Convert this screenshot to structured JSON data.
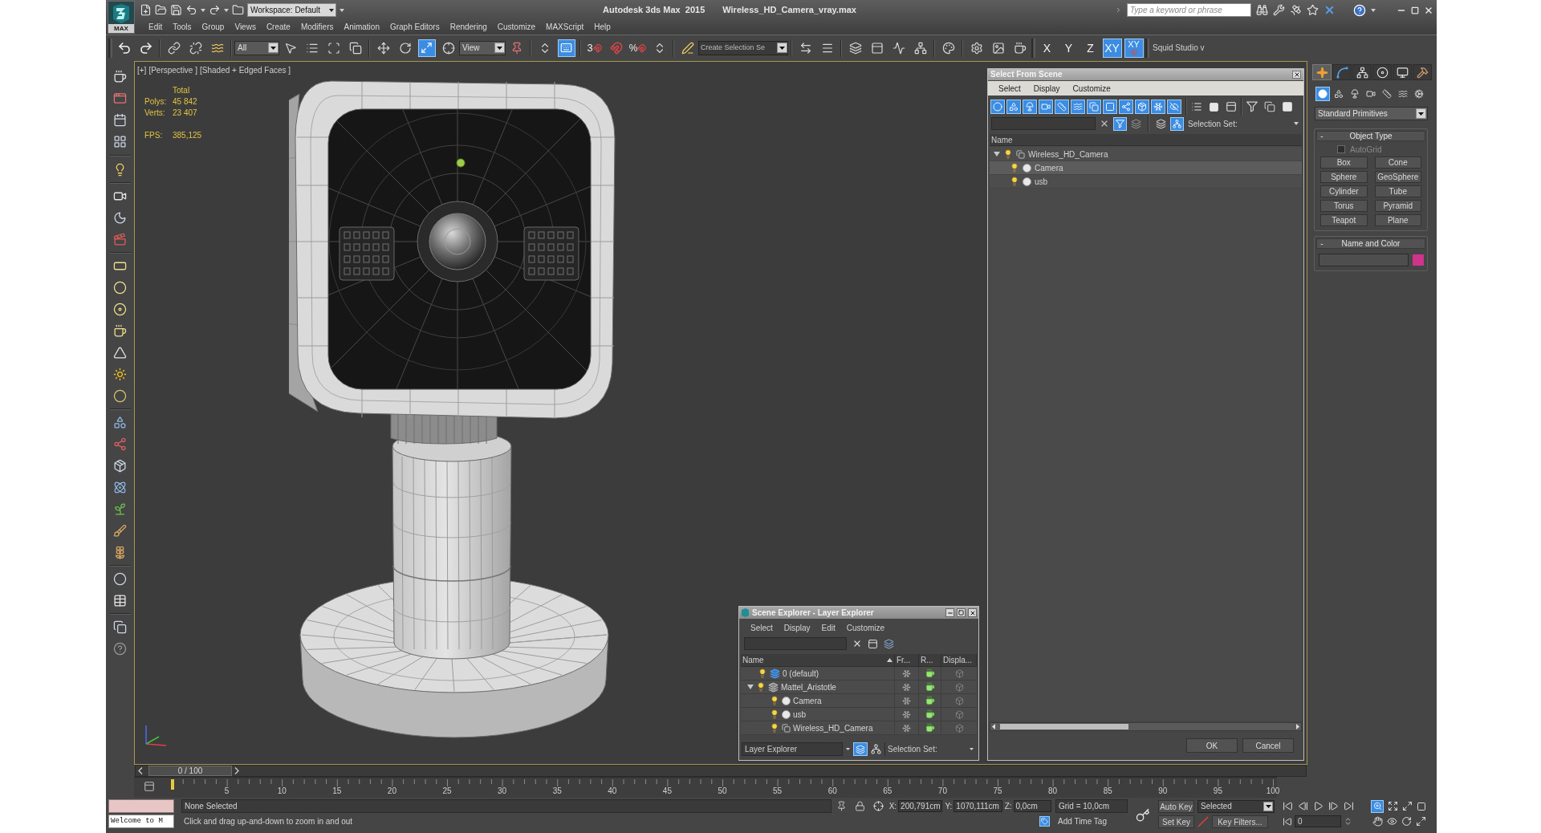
{
  "title_bar": {
    "app_button": "MAX",
    "workspace": "Workspace: Default",
    "app_name": "Autodesk 3ds Max  2015",
    "file_name": "Wireless_HD_Camera_vray.max",
    "search": {
      "placeholder": "Type a keyword or phrase"
    }
  },
  "menu": [
    "Edit",
    "Tools",
    "Group",
    "Views",
    "Create",
    "Modifiers",
    "Animation",
    "Graph Editors",
    "Rendering",
    "Customize",
    "MAXScript",
    "Help"
  ],
  "main_toolbar": {
    "selection_filter": "All",
    "scale_tool": {
      "active": true
    },
    "reference_coordinate": "View",
    "shortcut_override": {
      "active": true
    },
    "snap_toggle": "3",
    "percent_snap": "%",
    "named_selection": "Create Selection Se",
    "axis_constraints": [
      {
        "kind": "axis",
        "label": "X",
        "selected": false
      },
      {
        "kind": "axis",
        "label": "Y",
        "selected": false
      },
      {
        "kind": "axis",
        "label": "Z",
        "selected": false
      },
      {
        "kind": "axis",
        "label": "XY",
        "selected": true
      },
      {
        "kind": "snap",
        "label": "XY",
        "selected": true
      }
    ],
    "extra_toolbar": "Squid Studio v"
  },
  "viewport": {
    "labels": [
      "[+]",
      "[Perspective ]",
      "[Shaded + Edged Faces ]"
    ],
    "stats": {
      "header": "Total",
      "rows": [
        {
          "label": "Polys:",
          "value": "45 842"
        },
        {
          "label": "Verts:",
          "value": "23 407"
        }
      ],
      "fps_label": "FPS:",
      "fps": "385,125"
    }
  },
  "select_from_scene": {
    "title": "Select From Scene",
    "menu": [
      "Select",
      "Display",
      "Customize"
    ],
    "display_filters": [
      {
        "on": true
      },
      {
        "on": true
      },
      {
        "on": true
      },
      {
        "on": true
      },
      {
        "on": true
      },
      {
        "on": true
      },
      {
        "on": true
      },
      {
        "on": true
      },
      {
        "on": true
      },
      {
        "on": true
      },
      {
        "on": true
      },
      {
        "on": true
      }
    ],
    "filter_toggle": {
      "on": true
    },
    "hierarchy_view": {
      "on": true
    },
    "selection_set_label": "Selection Set:",
    "column": "Name",
    "tree": [
      {
        "name": "Wireless_HD_Camera",
        "kind": "group",
        "expanded": true,
        "selected": false,
        "children": [
          {
            "name": "Camera",
            "kind": "object",
            "selected": true
          },
          {
            "name": "usb",
            "kind": "object",
            "selected": false
          }
        ]
      }
    ],
    "buttons": [
      "OK",
      "Cancel"
    ]
  },
  "scene_explorer": {
    "title": "Scene Explorer - Layer Explorer",
    "menu": [
      "Select",
      "Display",
      "Edit",
      "Customize"
    ],
    "columns": [
      "Name",
      "Fr...",
      "R...",
      "Displa..."
    ],
    "tree": [
      {
        "name": "0 (default)",
        "kind": "layer",
        "active": true
      },
      {
        "name": "Mattel_Aristotle",
        "kind": "layer",
        "active": false,
        "expanded": true,
        "children": [
          {
            "name": "Camera",
            "kind": "object"
          },
          {
            "name": "usb",
            "kind": "object"
          },
          {
            "name": "Wireless_HD_Camera",
            "kind": "group"
          }
        ]
      }
    ],
    "explorer_mode": "Layer Explorer",
    "layer_view": {
      "on": true
    },
    "selection_set_label": "Selection Set:"
  },
  "command_panel": {
    "tabs": [
      {
        "selected": true
      },
      {
        "selected": false
      },
      {
        "selected": false
      },
      {
        "selected": false
      },
      {
        "selected": false
      },
      {
        "selected": false
      }
    ],
    "categories": [
      {
        "selected": true
      },
      {
        "selected": false
      },
      {
        "selected": false
      },
      {
        "selected": false
      },
      {
        "selected": false
      },
      {
        "selected": false
      },
      {
        "selected": false
      }
    ],
    "category_dropdown": "Standard Primitives",
    "object_type": {
      "toggle": "-",
      "title": "Object Type",
      "autogrid": {
        "label": "AutoGrid",
        "checked": false
      },
      "buttons": [
        "Box",
        "Cone",
        "Sphere",
        "GeoSphere",
        "Cylinder",
        "Tube",
        "Torus",
        "Pyramid",
        "Teapot",
        "Plane"
      ]
    },
    "name_and_color": {
      "toggle": "-",
      "title": "Name and Color",
      "color": "#cf348c"
    }
  },
  "time_slider": {
    "frame": "0 / 100",
    "level": 0
  },
  "track_bar": {
    "ticks": [
      "5",
      "10",
      "15",
      "20",
      "25",
      "30",
      "35",
      "40",
      "45",
      "50",
      "55",
      "60",
      "65",
      "70",
      "75",
      "80",
      "85",
      "90",
      "95",
      "100"
    ]
  },
  "status_bar": {
    "listener_output": "Welcome to M",
    "selection": "None Selected",
    "prompt": "Click and drag up-and-down to zoom in and out",
    "coordinates": [
      {
        "axis": "X:",
        "value": "200,791cm"
      },
      {
        "axis": "Y:",
        "value": "1070,111cm"
      },
      {
        "axis": "Z:",
        "value": "0,0cm"
      }
    ],
    "grid": "Grid = 10,0cm",
    "add_time_tag": "Add Time Tag",
    "auto_key": "Auto Key",
    "key_mode": "Selected",
    "set_key": "Set Key",
    "key_filters": "Key Filters...",
    "current_frame": "0",
    "zoom_tool": {
      "active": true
    }
  }
}
